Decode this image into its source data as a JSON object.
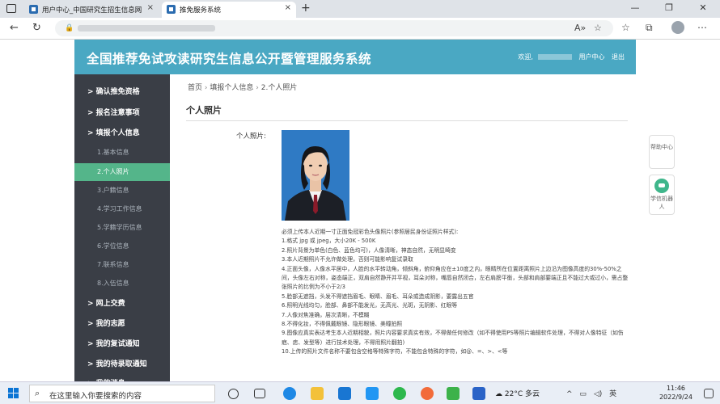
{
  "browser": {
    "tabs": [
      {
        "label": "用户中心_中国研究生招生信息网",
        "close": "×"
      },
      {
        "label": "推免服务系统",
        "close": "×"
      }
    ],
    "new_tab": "+",
    "window_buttons": [
      "—",
      "❐",
      "✕"
    ]
  },
  "header": {
    "title": "全国推荐免试攻读研究生信息公开暨管理服务系统",
    "welcome": "欢迎,",
    "user_center": "用户中心",
    "logout": "退出"
  },
  "sidebar": {
    "items": [
      {
        "label": "> 确认推免资格",
        "type": "main"
      },
      {
        "label": "> 报名注意事项",
        "type": "main"
      },
      {
        "label": "> 填报个人信息",
        "type": "main"
      },
      {
        "label": "1.基本信息",
        "type": "sub"
      },
      {
        "label": "2.个人照片",
        "type": "sub",
        "active": true
      },
      {
        "label": "3.户籍信息",
        "type": "sub"
      },
      {
        "label": "4.学习工作信息",
        "type": "sub"
      },
      {
        "label": "5.学籍学历信息",
        "type": "sub"
      },
      {
        "label": "6.学位信息",
        "type": "sub"
      },
      {
        "label": "7.联系信息",
        "type": "sub"
      },
      {
        "label": "8.入伍信息",
        "type": "sub"
      },
      {
        "label": "> 网上交费",
        "type": "main"
      },
      {
        "label": "> 我的志愿",
        "type": "main"
      },
      {
        "label": "> 我的复试通知",
        "type": "main"
      },
      {
        "label": "> 我的待录取通知",
        "type": "main"
      },
      {
        "label": "> 我的消息",
        "type": "main"
      }
    ]
  },
  "breadcrumb": {
    "home": "首页",
    "sep": "›",
    "level1": "填报个人信息",
    "level2": "2.个人照片"
  },
  "section_title": "个人照片",
  "photo_label": "个人照片:",
  "notes": [
    "必须上传本人近期一寸正面免冠彩色头像照片(参照居民身份证照片样式):",
    "1.格式 jpg 或 jpeg，大小20K - 500K",
    "2.照片背景为单色(白色、蓝色均可)，人像清晰，神态自然，无明显畸变",
    "3.本人近期照片不允许做处理，否则可能影响复试录取",
    "4.正面头像，人像水平居中，人脸的水平转动角，倾斜角，俯仰角应在±10度之内，眼睛所在位置距离照片上边沿为图像高度的30%-50%之间，头像左右对称，姿态端正，双肩自然静开并平视，耳朵对称，嘴唇自然闭合，左右肩膀平衡，头部和肩部要端正且不能过大或过小，需占整张照片的比例为不小于2/3",
    "5.脸部无遮挡，头发不得遮挡眉毛、眼睛、眉毛、耳朵或造成阴影，要露出五官",
    "6.照明光线均匀，脸部、鼻部不能发光，无高光、光斑，无阴影、红眼等",
    "7.人像对焦准确，层次清晰，不模糊",
    "8.不得化妆，不得佩戴眼镜、隐形眼镜、美瞳拍照",
    "9.图像应真实表达考生本人近期相貌，照片内容要求真实有效，不得做任何修改（如不得使用PS等照片编辑软件处理，不得对人像特征（如伤疤、痣、发型等）进行技术处理，不得用照片翻拍)",
    "10.上传的照片文件名称不要包含空格等特殊字符，不能包含特殊的字符，如@、=、>、<等"
  ],
  "help": {
    "label": "帮助中心"
  },
  "robot": {
    "label": "学信机器人"
  },
  "taskbar": {
    "search_placeholder": "在这里输入你要搜索的内容",
    "weather": "22°C 多云",
    "ime": "英",
    "time": "11:46",
    "date": "2022/9/24"
  }
}
